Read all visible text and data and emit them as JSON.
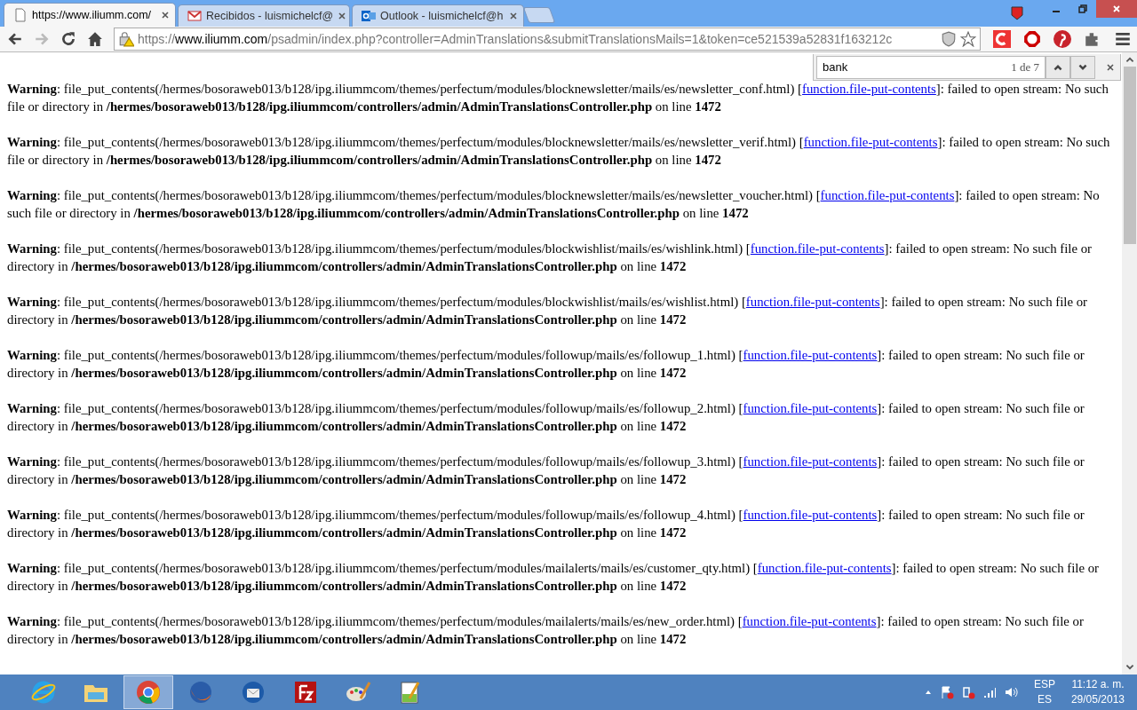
{
  "tabs": [
    {
      "title": "https://www.iliumm.com/",
      "kind": "page",
      "selected": true
    },
    {
      "title": "Recibidos - luismichelcf@",
      "kind": "mail",
      "selected": false
    },
    {
      "title": "Outlook - luismichelcf@h",
      "kind": "outlook",
      "selected": false
    }
  ],
  "address_bar": {
    "scheme": "https://",
    "host": "www.iliumm.com",
    "rest": "/psadmin/index.php?controller=AdminTranslations&submitTranslationsMails=1&token=ce521539a52831f163212c"
  },
  "find_bar": {
    "query": "bank",
    "count": "1 de 7"
  },
  "warnings": [
    {
      "before": "**Warning**: file_put_contents(/hermes/bosoraweb013/b128/ipg.iliummcom/themes/perfectum/modules/blocknewsletter/mails/es/newsletter_conf.html) [",
      "link": "function.file-put-contents",
      "after": "]: failed to open stream: No such file or directory in **/hermes/bosoraweb013/b128/ipg.iliummcom/controllers/admin/AdminTranslationsController.php** on line **1472**"
    },
    {
      "before": "**Warning**: file_put_contents(/hermes/bosoraweb013/b128/ipg.iliummcom/themes/perfectum/modules/blocknewsletter/mails/es/newsletter_verif.html) [",
      "link": "function.file-put-contents",
      "after": "]: failed to open stream: No such file or directory in **/hermes/bosoraweb013/b128/ipg.iliummcom/controllers/admin/AdminTranslationsController.php** on line **1472**"
    },
    {
      "before": "**Warning**: file_put_contents(/hermes/bosoraweb013/b128/ipg.iliummcom/themes/perfectum/modules/blocknewsletter/mails/es/newsletter_voucher.html) [",
      "link": "function.file-put-contents",
      "after": "]: failed to open stream: No such file or directory in **/hermes/bosoraweb013/b128/ipg.iliummcom/controllers/admin/AdminTranslationsController.php** on line **1472**"
    },
    {
      "before": "**Warning**: file_put_contents(/hermes/bosoraweb013/b128/ipg.iliummcom/themes/perfectum/modules/blockwishlist/mails/es/wishlink.html) [",
      "link": "function.file-put-contents",
      "after": "]: failed to open stream: No such file or directory in **/hermes/bosoraweb013/b128/ipg.iliummcom/controllers/admin/AdminTranslationsController.php** on line **1472**"
    },
    {
      "before": "**Warning**: file_put_contents(/hermes/bosoraweb013/b128/ipg.iliummcom/themes/perfectum/modules/blockwishlist/mails/es/wishlist.html) [",
      "link": "function.file-put-contents",
      "after": "]: failed to open stream: No such file or directory in **/hermes/bosoraweb013/b128/ipg.iliummcom/controllers/admin/AdminTranslationsController.php** on line **1472**"
    },
    {
      "before": "**Warning**: file_put_contents(/hermes/bosoraweb013/b128/ipg.iliummcom/themes/perfectum/modules/followup/mails/es/followup_1.html) [",
      "link": "function.file-put-contents",
      "after": "]: failed to open stream: No such file or directory in **/hermes/bosoraweb013/b128/ipg.iliummcom/controllers/admin/AdminTranslationsController.php** on line **1472**"
    },
    {
      "before": "**Warning**: file_put_contents(/hermes/bosoraweb013/b128/ipg.iliummcom/themes/perfectum/modules/followup/mails/es/followup_2.html) [",
      "link": "function.file-put-contents",
      "after": "]: failed to open stream: No such file or directory in **/hermes/bosoraweb013/b128/ipg.iliummcom/controllers/admin/AdminTranslationsController.php** on line **1472**"
    },
    {
      "before": "**Warning**: file_put_contents(/hermes/bosoraweb013/b128/ipg.iliummcom/themes/perfectum/modules/followup/mails/es/followup_3.html) [",
      "link": "function.file-put-contents",
      "after": "]: failed to open stream: No such file or directory in **/hermes/bosoraweb013/b128/ipg.iliummcom/controllers/admin/AdminTranslationsController.php** on line **1472**"
    },
    {
      "before": "**Warning**: file_put_contents(/hermes/bosoraweb013/b128/ipg.iliummcom/themes/perfectum/modules/followup/mails/es/followup_4.html) [",
      "link": "function.file-put-contents",
      "after": "]: failed to open stream: No such file or directory in **/hermes/bosoraweb013/b128/ipg.iliummcom/controllers/admin/AdminTranslationsController.php** on line **1472**"
    },
    {
      "before": "**Warning**: file_put_contents(/hermes/bosoraweb013/b128/ipg.iliummcom/themes/perfectum/modules/mailalerts/mails/es/customer_qty.html) [",
      "link": "function.file-put-contents",
      "after": "]: failed to open stream: No such file or directory in **/hermes/bosoraweb013/b128/ipg.iliummcom/controllers/admin/AdminTranslationsController.php** on line **1472**"
    },
    {
      "before": "**Warning**: file_put_contents(/hermes/bosoraweb013/b128/ipg.iliummcom/themes/perfectum/modules/mailalerts/mails/es/new_order.html) [",
      "link": "function.file-put-contents",
      "after": "]: failed to open stream: No such file or directory in **/hermes/bosoraweb013/b128/ipg.iliummcom/controllers/admin/AdminTranslationsController.php** on line **1472**"
    }
  ],
  "taskbar": {
    "apps": [
      {
        "kind": "ie",
        "selected": false
      },
      {
        "kind": "explorer",
        "selected": false
      },
      {
        "kind": "chrome",
        "selected": true
      },
      {
        "kind": "firefox",
        "selected": false
      },
      {
        "kind": "thunderbird",
        "selected": false
      },
      {
        "kind": "filezilla",
        "selected": false
      },
      {
        "kind": "paint",
        "selected": false
      },
      {
        "kind": "notepad",
        "selected": false
      }
    ],
    "language": "ESP",
    "layout": "ES",
    "time": "11:12 a. m.",
    "date": "29/05/2013"
  }
}
